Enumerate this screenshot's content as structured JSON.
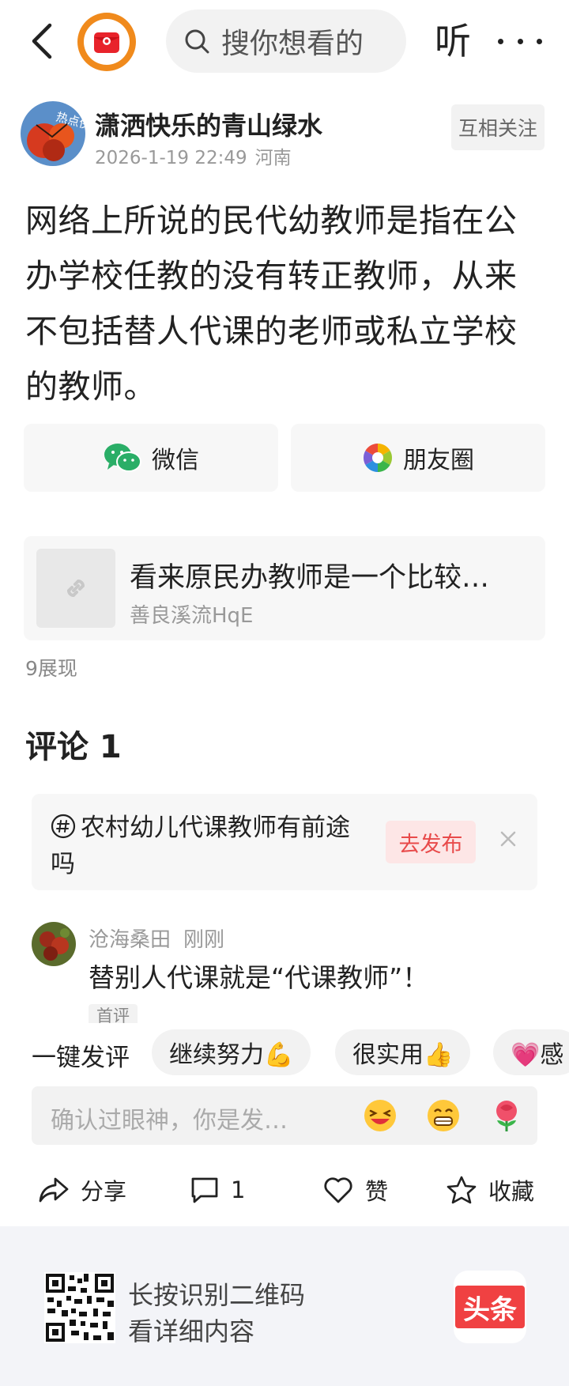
{
  "header": {
    "search_placeholder": "搜你想看的",
    "listen_label": "听"
  },
  "author": {
    "name": "潇洒快乐的青山绿水",
    "date": "2026-1-19 22:49",
    "location": "河南",
    "avatar_badge": "热点侠",
    "follow_label": "互相关注"
  },
  "post": {
    "text": "网络上所说的民代幼教师是指在公办学校任教的没有转正教师，从来不包括替人代课的老师或私立学校的教师。"
  },
  "share": {
    "wechat_label": "微信",
    "moments_label": "朋友圈"
  },
  "linked": {
    "title": "看来原民办教师是一个比较…",
    "author": "善良溪流HqE"
  },
  "views_label": "9展现",
  "comments": {
    "title": "评论 1",
    "topic_text": "农村幼儿代课教师有前途吗",
    "publish_label": "去发布",
    "items": [
      {
        "user": "沧海桑田",
        "time": "刚刚",
        "text": "替别人代课就是“代课教师”！",
        "badge": "首评"
      }
    ]
  },
  "quick": {
    "label": "一键发评",
    "chips": [
      "继续努力💪",
      "很实用👍",
      "💗感"
    ]
  },
  "comment_input": {
    "placeholder": "确认过眼神，你是发…",
    "emojis": [
      "😆",
      "😁",
      "🌷"
    ]
  },
  "actions": {
    "share_label": "分享",
    "comment_count": "1",
    "like_label": "赞",
    "favorite_label": "收藏"
  },
  "footer": {
    "line1": "长按识别二维码",
    "line2": "看详细内容",
    "brand": "头条"
  }
}
